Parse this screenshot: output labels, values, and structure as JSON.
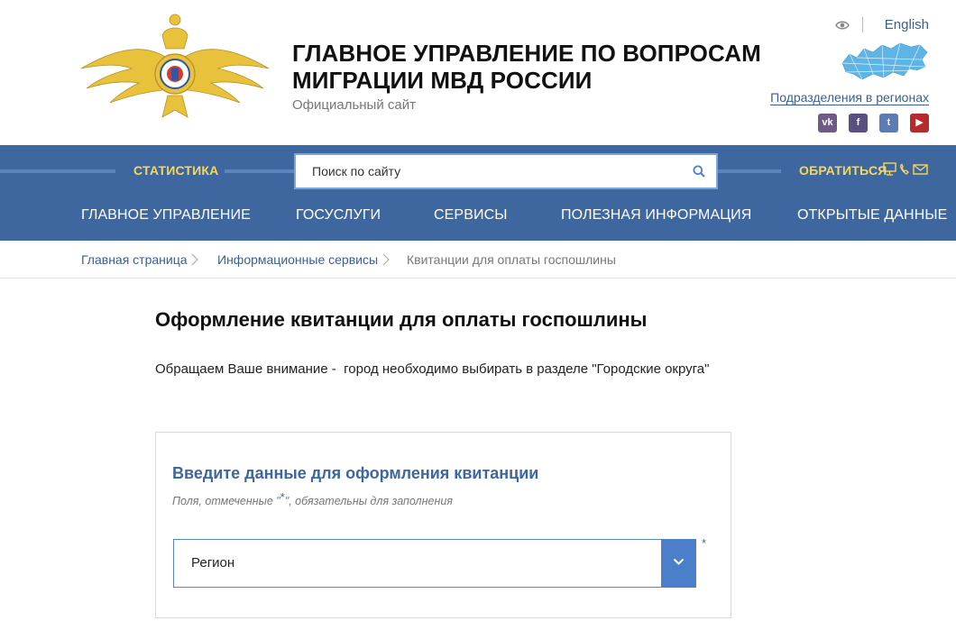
{
  "header": {
    "title_line1": "ГЛАВНОЕ УПРАВЛЕНИЕ ПО ВОПРОСАМ",
    "title_line2": "МИГРАЦИИ МВД РОССИИ",
    "subtitle": "Официальный сайт",
    "lang_link": "English",
    "regions_link": "Подразделения в регионах",
    "social": [
      {
        "icon": "vk-icon",
        "glyph": "vk",
        "color": "#6d5b86"
      },
      {
        "icon": "facebook-icon",
        "glyph": "f",
        "color": "#5a4f7e"
      },
      {
        "icon": "twitter-icon",
        "glyph": "t",
        "color": "#5c7bb4"
      },
      {
        "icon": "youtube-icon",
        "glyph": "▶",
        "color": "#b52a2a"
      }
    ]
  },
  "navband": {
    "stats_label": "СТАТИСТИКА",
    "search_placeholder": "Поиск по сайту",
    "contact_label": "ОБРАТИТЬСЯ",
    "menu": [
      "ГЛАВНОЕ УПРАВЛЕНИЕ",
      "ГОСУСЛУГИ",
      "СЕРВИСЫ",
      "ПОЛЕЗНАЯ ИНФОРМАЦИЯ",
      "ОТКРЫТЫЕ ДАННЫЕ"
    ]
  },
  "breadcrumbs": [
    "Главная страница",
    "Информационные сервисы",
    "Квитанции для оплаты госпошлины"
  ],
  "content": {
    "title": "Оформление квитанции для оплаты госпошлины",
    "notice": "Обращаем Ваше внимание -  город необходимо выбирать в разделе \"Городские округа\""
  },
  "form": {
    "heading": "Введите данные для оформления квитанции",
    "hint_before": "Поля, отмеченные \"",
    "hint_star": "*",
    "hint_after": "\", обязательны для заполнения",
    "region_value": "Регион",
    "required_mark": "*"
  },
  "colors": {
    "nav_blue": "#3e669f",
    "accent_yellow": "#f7d75c",
    "link_blue": "#3a5f8f",
    "select_button": "#4c7fc9"
  }
}
